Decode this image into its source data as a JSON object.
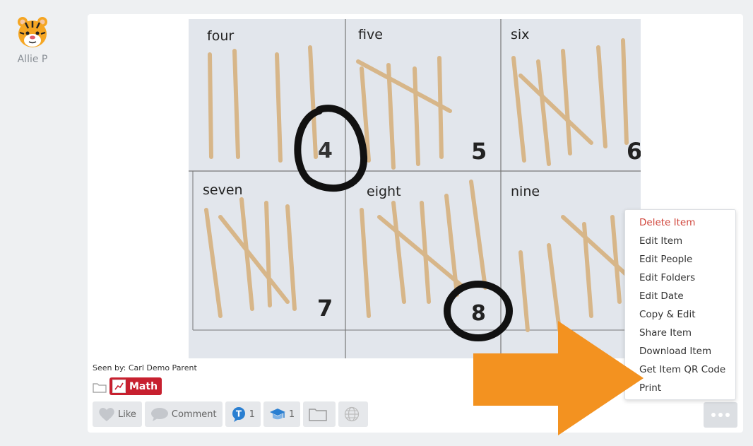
{
  "author": {
    "name": "Allie P",
    "avatar": "tiger-face-icon"
  },
  "photo": {
    "grid_labels": [
      "four",
      "five",
      "six",
      "seven",
      "eight",
      "nine"
    ],
    "digits": [
      "4",
      "5",
      "6",
      "7",
      "8"
    ]
  },
  "post": {
    "seen_by": "Seen by: Carl Demo Parent",
    "tag": "Math",
    "like_label": "Like",
    "comment_label": "Comment",
    "teacher_count": "1",
    "teacher_badge": "T",
    "student_count": "1"
  },
  "menu": {
    "items": [
      "Delete Item",
      "Edit Item",
      "Edit People",
      "Edit Folders",
      "Edit Date",
      "Copy & Edit",
      "Share Item",
      "Download Item",
      "Get Item QR Code",
      "Print"
    ]
  },
  "colors": {
    "accent": "#c7202f",
    "arrow": "#f39220",
    "danger": "#d0453b",
    "teacher": "#2a7fd1"
  }
}
